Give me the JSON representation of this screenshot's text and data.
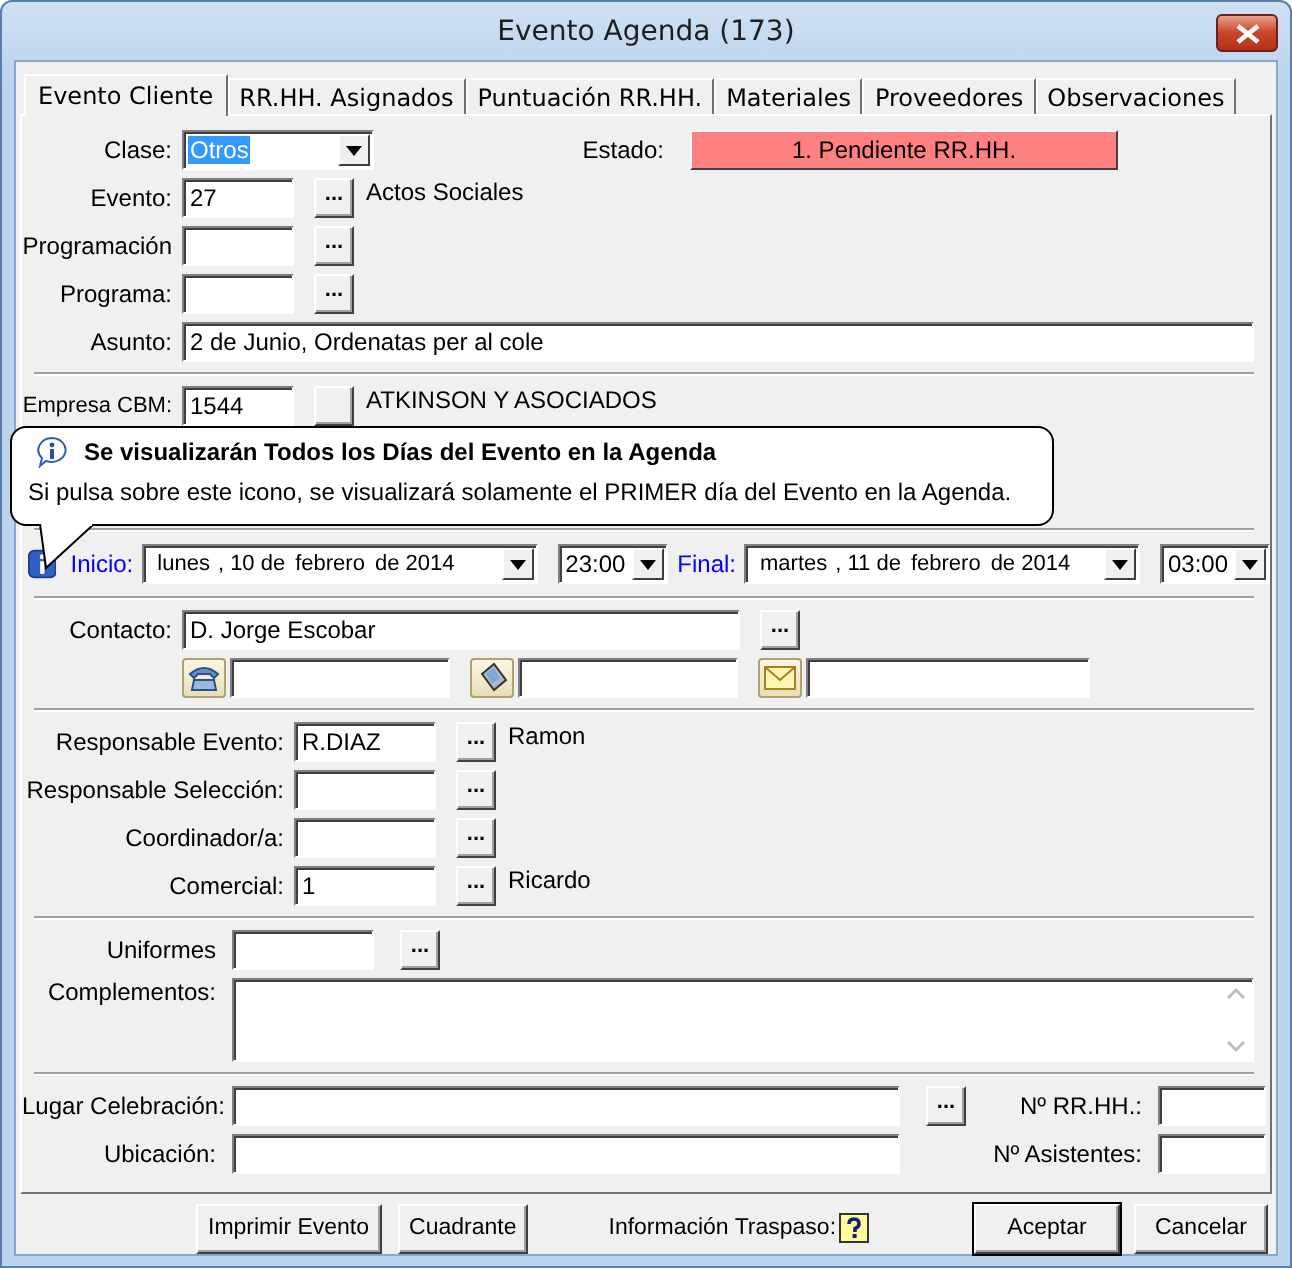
{
  "window": {
    "title": "Evento Agenda (173)"
  },
  "tabs": [
    {
      "label": "Evento Cliente",
      "selected": true
    },
    {
      "label": "RR.HH. Asignados",
      "selected": false
    },
    {
      "label": "Puntuación RR.HH.",
      "selected": false
    },
    {
      "label": "Materiales",
      "selected": false
    },
    {
      "label": "Proveedores",
      "selected": false
    },
    {
      "label": "Observaciones",
      "selected": false
    }
  ],
  "clase": {
    "label": "Clase:",
    "value": "Otros",
    "focused": true
  },
  "estado": {
    "label": "Estado:",
    "value": "1. Pendiente RR.HH."
  },
  "rows": [
    {
      "kind": "lookup",
      "label": "Evento:",
      "value": "27",
      "button": "...",
      "note": "Actos Sociales"
    },
    {
      "kind": "lookup",
      "label": "Programación",
      "button": "..."
    },
    {
      "kind": "lookup",
      "label": "Programa:",
      "button": "..."
    },
    {
      "kind": "text",
      "label": "Asunto:",
      "value": "2 de Junio, Ordenatas per al cole"
    }
  ],
  "empresa": {
    "label": "Empresa CBM:",
    "value": "1544",
    "note": "ATKINSON Y ASOCIADOS"
  },
  "tooltip": {
    "title": "Se visualizarán Todos los Días del Evento en la Agenda",
    "text": "Si pulsa sobre este icono, se visualizará solamente el PRIMER día del Evento en la Agenda."
  },
  "dates": [
    {
      "label": "Inicio:",
      "parts": [
        "lunes",
        ", 10 de",
        "febrero",
        "de 2014"
      ],
      "time": "23:00"
    },
    {
      "label": "Final:",
      "parts": [
        "martes",
        ", 11 de",
        "febrero",
        "de 2014"
      ],
      "time": "03:00"
    }
  ],
  "contacto": {
    "label": "Contacto:",
    "value": "D. Jorge Escobar",
    "button": "...",
    "channels": [
      {
        "kind": "phone"
      },
      {
        "kind": "mobile"
      },
      {
        "kind": "email"
      }
    ]
  },
  "responsables": [
    {
      "label": "Responsable Evento:",
      "value": "R.DIAZ",
      "button": "...",
      "note": "Ramon"
    },
    {
      "label": "Responsable Selección:",
      "button": "..."
    },
    {
      "label": "Coordinador/a:",
      "button": "..."
    },
    {
      "label": "Comercial:",
      "value": "1",
      "button": "...",
      "note": "Ricardo"
    }
  ],
  "uniformes": {
    "label": "Uniformes",
    "button": "..."
  },
  "complementos": {
    "label": "Complementos:"
  },
  "lugar": {
    "label": "Lugar Celebración:",
    "button": "..."
  },
  "ubicacion": {
    "label": "Ubicación:"
  },
  "nrrhh": {
    "label": "Nº RR.HH.:"
  },
  "asistentes": {
    "label": "Nº Asistentes:"
  },
  "buttons": [
    {
      "kind": "push",
      "label": "Imprimir Evento"
    },
    {
      "kind": "push",
      "label": "Cuadrante"
    },
    {
      "kind": "help",
      "label": "Información Traspaso:"
    },
    {
      "kind": "default",
      "label": "Aceptar"
    },
    {
      "kind": "push",
      "label": "Cancelar"
    }
  ]
}
